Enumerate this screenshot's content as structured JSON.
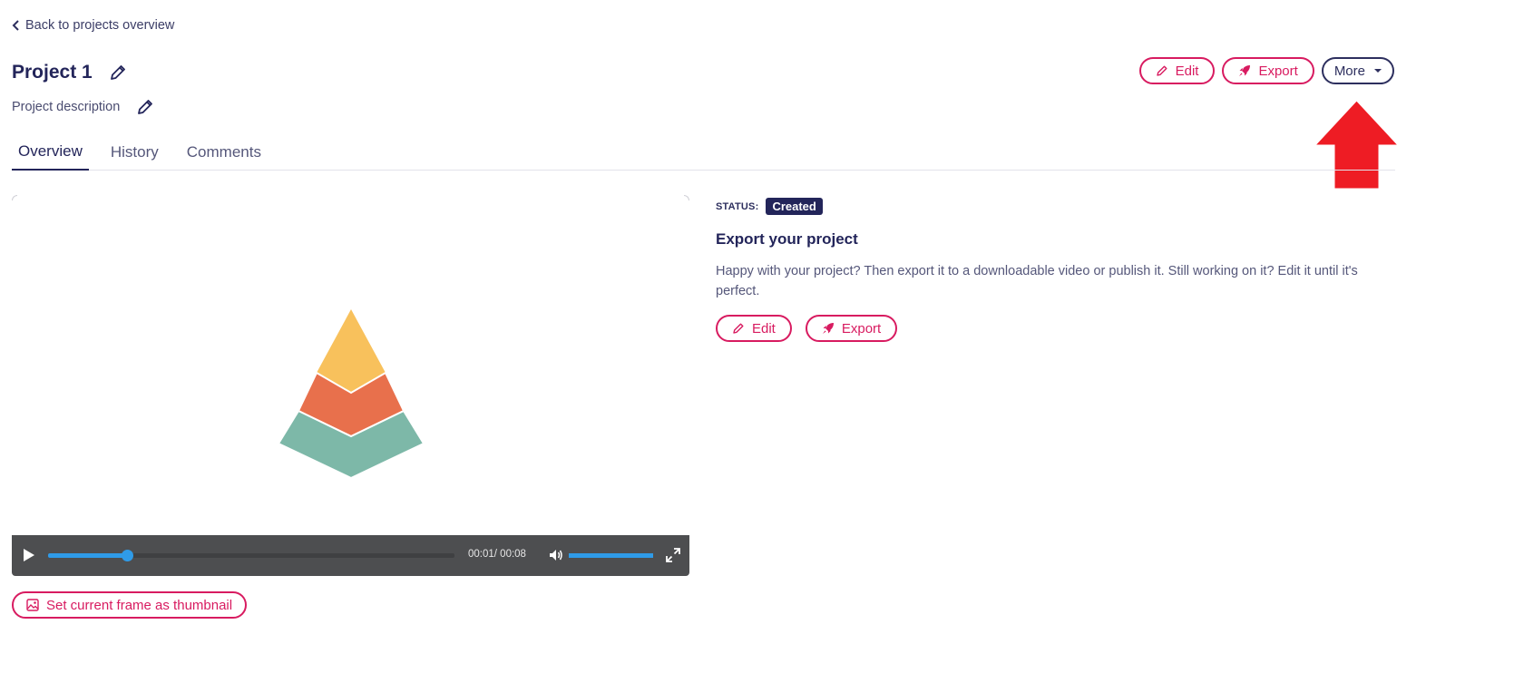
{
  "nav": {
    "back_label": "Back to projects overview"
  },
  "project": {
    "title": "Project 1",
    "description": "Project description"
  },
  "header_actions": {
    "edit_label": "Edit",
    "export_label": "Export",
    "more_label": "More"
  },
  "tabs": [
    {
      "label": "Overview",
      "active": true
    },
    {
      "label": "History",
      "active": false
    },
    {
      "label": "Comments",
      "active": false
    }
  ],
  "player": {
    "time_text": "00:01/ 00:08",
    "progress_fraction": 0.195,
    "volume_fraction": 1.0
  },
  "thumbnail_button_label": "Set current frame as thumbnail",
  "status": {
    "label": "STATUS:",
    "value": "Created"
  },
  "export_section": {
    "heading": "Export your project",
    "text": "Happy with your project? Then export it to a downloadable video or publish it. Still working on it? Edit it until it's perfect.",
    "edit_label": "Edit",
    "export_label": "Export"
  },
  "colors": {
    "accent": "#d81b60",
    "navy": "#23255a",
    "player_bg": "#4d4e50",
    "player_progress": "#2f9be8",
    "annotation_arrow": "#ee1c24",
    "pyramid_top": "#f8c15c",
    "pyramid_middle": "#e8704c",
    "pyramid_bottom": "#7db8a8"
  }
}
